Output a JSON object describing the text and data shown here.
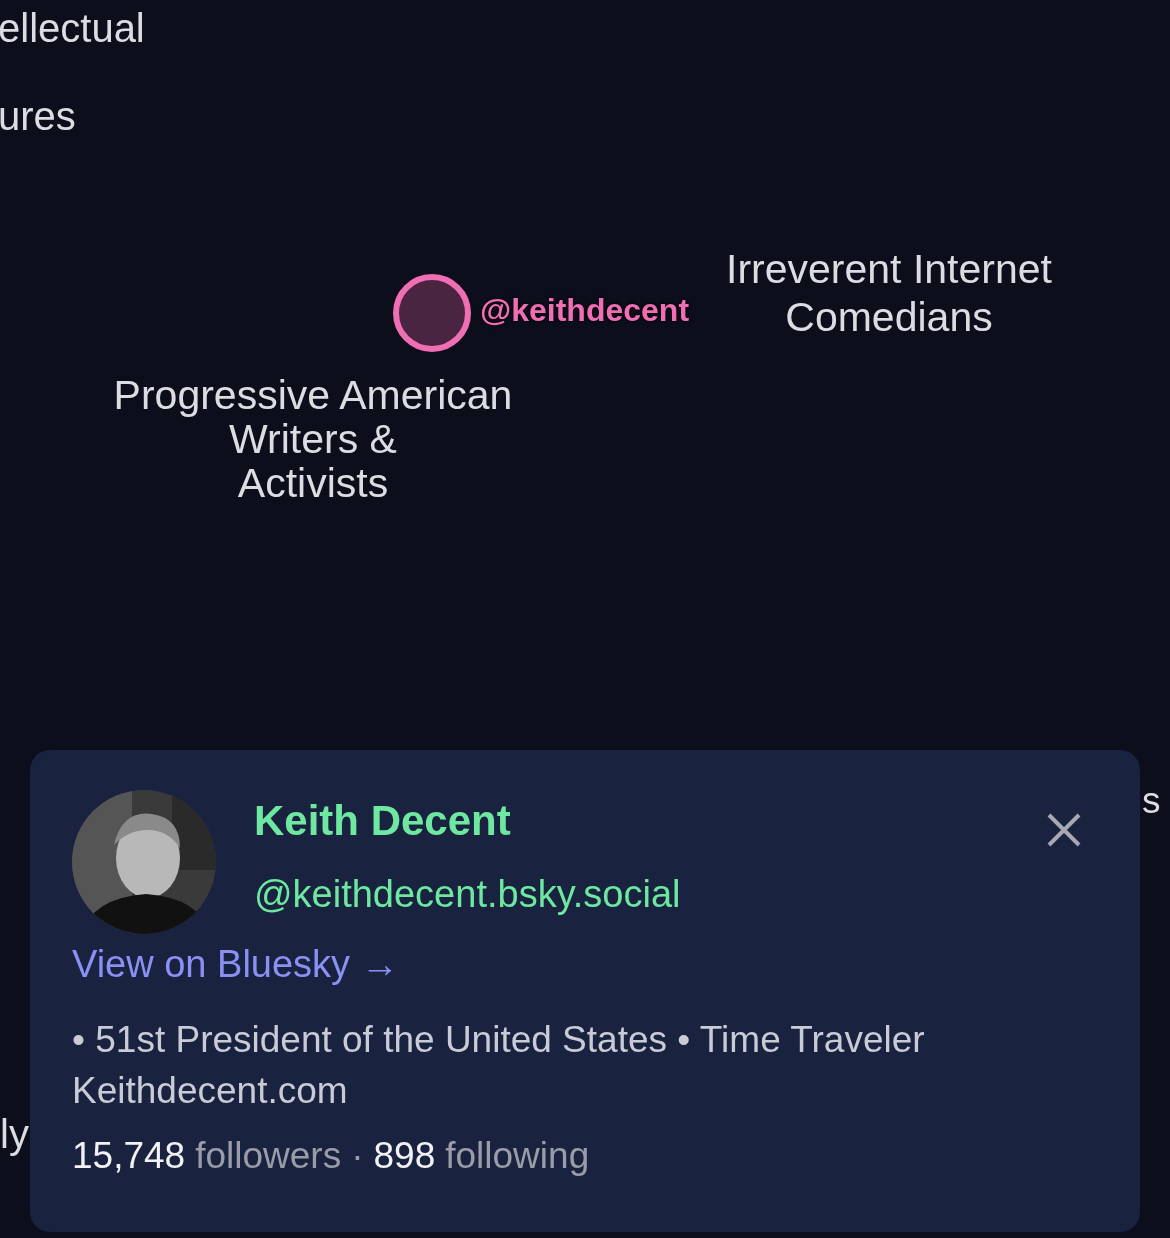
{
  "map": {
    "labels": [
      {
        "text": "ellectual"
      },
      {
        "text": "ures"
      },
      {
        "text": "Irreverent Internet\nComedians"
      },
      {
        "text": "Progressive American\nWriters &\nActivists"
      },
      {
        "text": "s"
      },
      {
        "text": "ly"
      }
    ],
    "node": {
      "label": "@keithdecent",
      "color": "#f06eb4"
    }
  },
  "profile_card": {
    "name": "Keith Decent",
    "handle": "@keithdecent.bsky.social",
    "link": "View on Bluesky →",
    "bio": [
      "• 51st President of the United States • Time Traveler",
      "Keithdecent.com"
    ],
    "followers_count": "15,748",
    "followers_label": "followers",
    "separator": "·",
    "following_count": "898",
    "following_label": "following"
  }
}
